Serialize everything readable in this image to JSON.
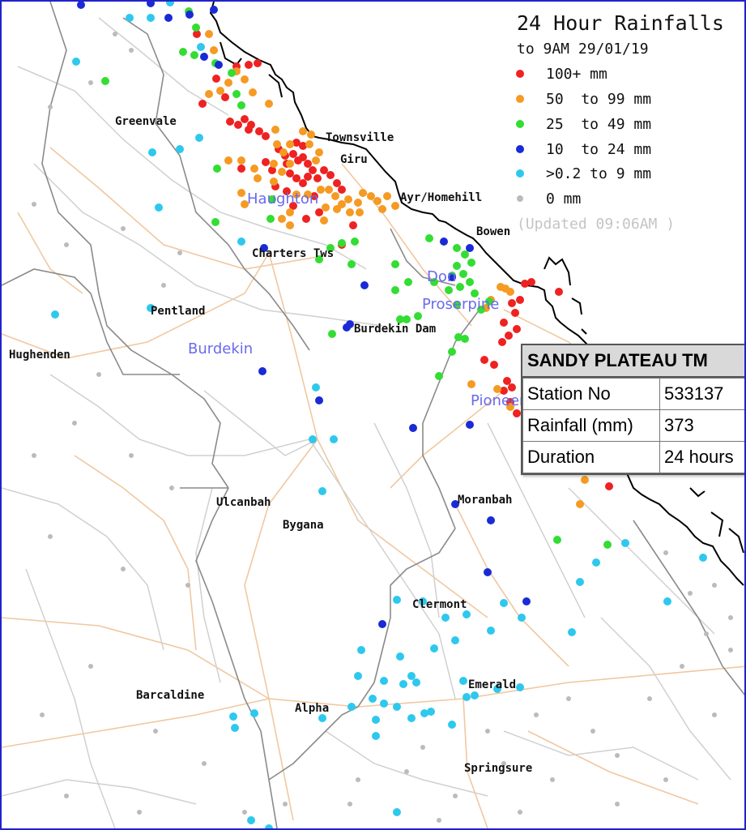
{
  "legend": {
    "title": "24 Hour Rainfalls",
    "subtitle": "to 9AM 29/01/19",
    "items": [
      {
        "label": "100+ mm",
        "color": "#ee2222"
      },
      {
        "label": "50  to 99 mm",
        "color": "#f59a23"
      },
      {
        "label": "25  to 49 mm",
        "color": "#33dd33"
      },
      {
        "label": "10  to 24 mm",
        "color": "#1a2ad6"
      },
      {
        "label": ">0.2 to 9 mm",
        "color": "#2ec8ee"
      },
      {
        "label": "0 mm",
        "color": "#bbbbbb"
      }
    ],
    "updated": "(Updated 09:06AM  )"
  },
  "towns": [
    {
      "name": "Greenvale"
    },
    {
      "name": "Townsville"
    },
    {
      "name": "Giru"
    },
    {
      "name": "Ayr/Homehill"
    },
    {
      "name": "Bowen"
    },
    {
      "name": "Charters Tws"
    },
    {
      "name": "Pentland"
    },
    {
      "name": "Hughenden"
    },
    {
      "name": "Burdekin Dam"
    },
    {
      "name": "Ulcanbah"
    },
    {
      "name": "Bygana"
    },
    {
      "name": "Moranbah"
    },
    {
      "name": "Clermont"
    },
    {
      "name": "Emerald"
    },
    {
      "name": "Barcaldine"
    },
    {
      "name": "Alpha"
    },
    {
      "name": "Springsure"
    }
  ],
  "basins": [
    {
      "name": "Haughton"
    },
    {
      "name": "Burdekin"
    },
    {
      "name": "Don"
    },
    {
      "name": "Proserpine"
    },
    {
      "name": "Pioneer"
    }
  ],
  "popup": {
    "title": "SANDY PLATEAU TM",
    "rows": [
      {
        "label": "Station No",
        "value": "533137"
      },
      {
        "label": "Rainfall (mm)",
        "value": "373"
      },
      {
        "label": "Duration",
        "value": "24 hours"
      }
    ]
  },
  "colors": {
    "frame_border": "#2222cc",
    "coastline": "#000000",
    "river": "#d0d0d0",
    "road": "#f0c8a0",
    "basin_boundary": "#8a8a8a"
  }
}
